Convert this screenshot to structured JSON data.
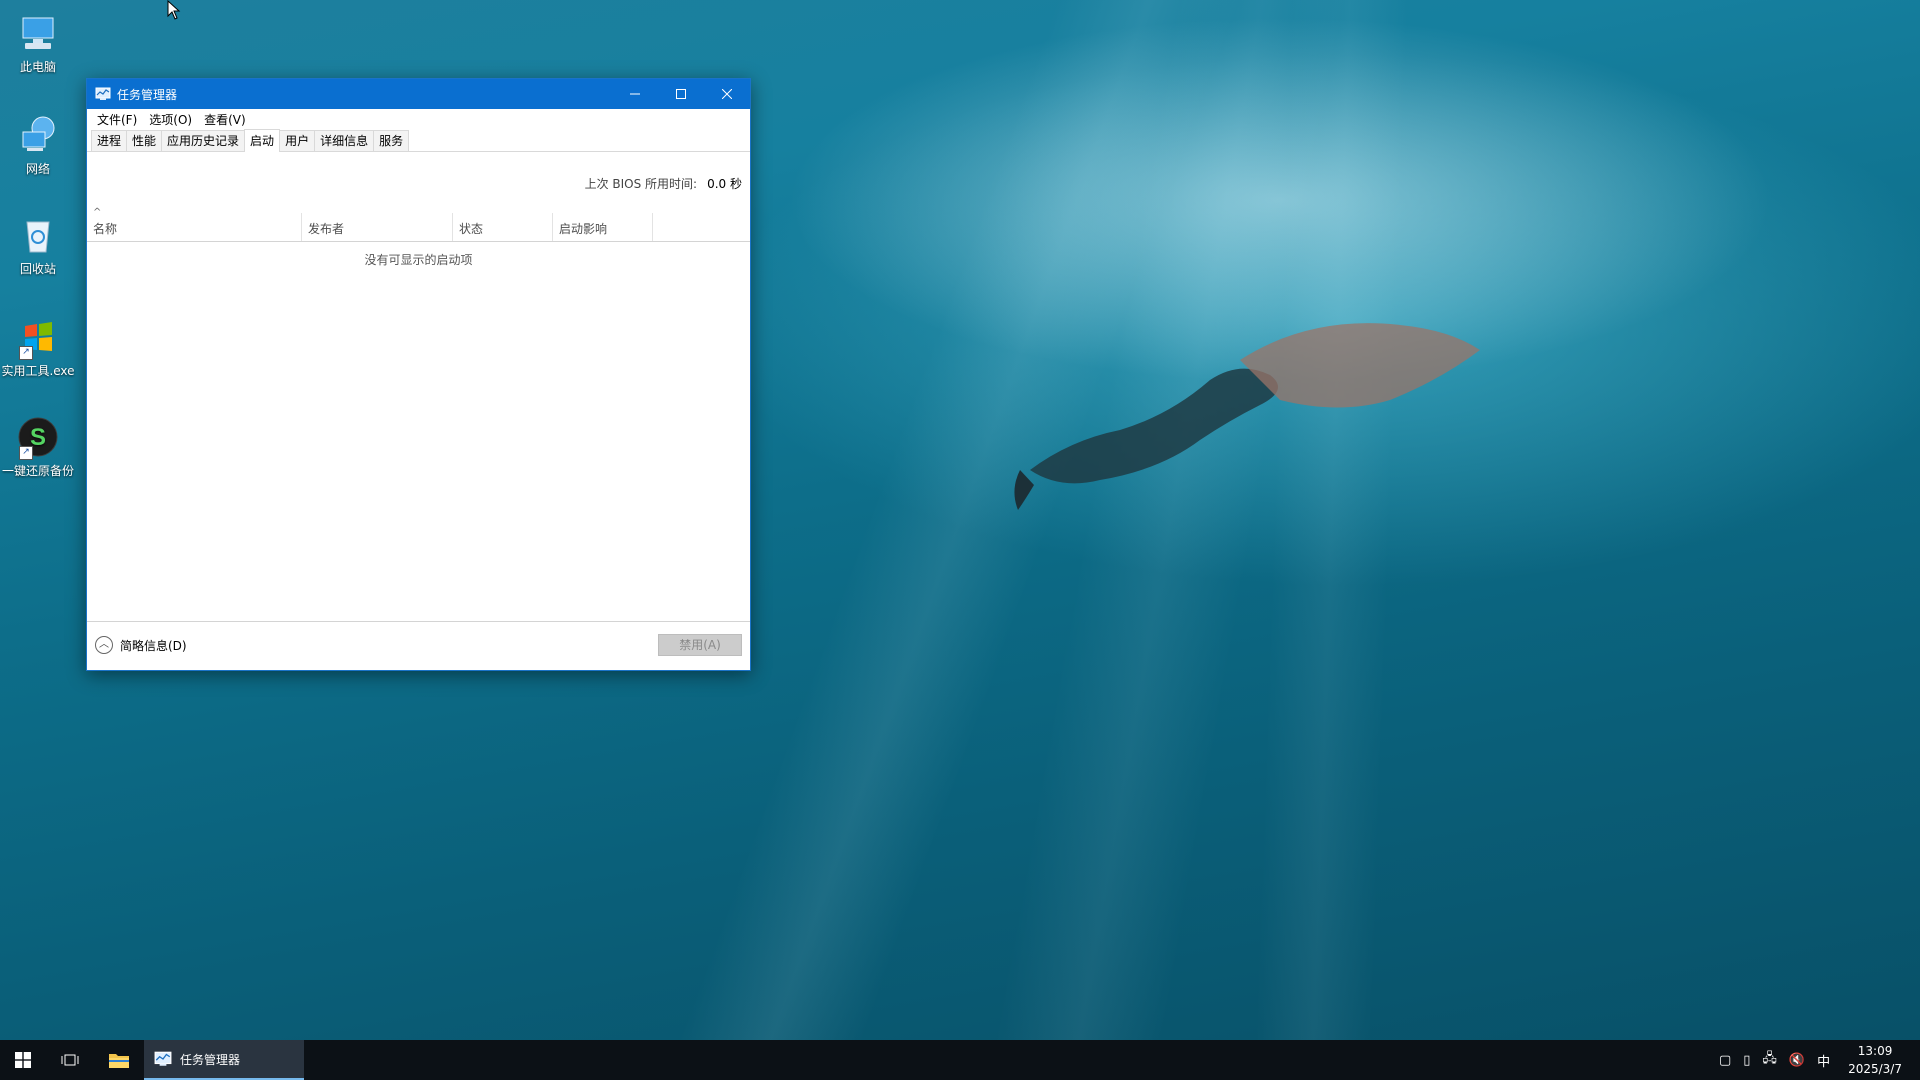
{
  "desktop": {
    "icons": [
      {
        "label": "此电脑"
      },
      {
        "label": "网络"
      },
      {
        "label": "回收站"
      },
      {
        "label": "实用工具.exe"
      },
      {
        "label": "一键还原备份"
      }
    ]
  },
  "window": {
    "title": "任务管理器",
    "menu": [
      "文件(F)",
      "选项(O)",
      "查看(V)"
    ],
    "tabs": [
      "进程",
      "性能",
      "应用历史记录",
      "启动",
      "用户",
      "详细信息",
      "服务"
    ],
    "active_tab": "启动",
    "bios_label": "上次 BIOS 所用时间:",
    "bios_value": "0.0 秒",
    "columns": [
      "名称",
      "发布者",
      "状态",
      "启动影响"
    ],
    "empty_message": "没有可显示的启动项",
    "fewer_details": "简略信息(D)",
    "disable_button": "禁用(A)"
  },
  "taskbar": {
    "app_label": "任务管理器",
    "ime": "中",
    "time": "13:09",
    "date": "2025/3/7"
  },
  "colors": {
    "titlebar": "#0a6fd0",
    "taskbar": "#0c1116"
  }
}
